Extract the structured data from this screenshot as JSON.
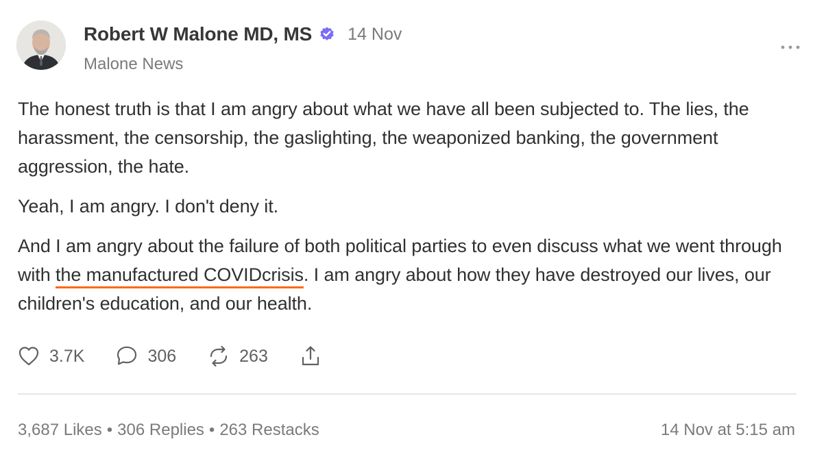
{
  "author": {
    "name": "Robert W Malone MD, MS",
    "publication": "Malone News",
    "date": "14 Nov",
    "verified_color": "#7b6df6"
  },
  "post": {
    "paragraphs": [
      {
        "text": "The honest truth is that I am angry about what we have all been subjected to. The lies, the harassment, the censorship, the gaslighting, the weaponized banking, the government aggression, the hate."
      },
      {
        "text": "Yeah, I am angry. I don't deny it."
      },
      {
        "before": "And I am angry about the failure of both political parties to even discuss what we went through with ",
        "link": "the manufactured COVIDcrisis",
        "after": ". I am angry about how they have destroyed our lives, our children's education, and our health."
      }
    ],
    "link_underline_color": "#ff6719"
  },
  "actions": {
    "likes": "3.7K",
    "replies": "306",
    "restacks": "263"
  },
  "stats": {
    "likes": "3,687 Likes",
    "separator": "•",
    "replies": "306 Replies",
    "restacks": "263 Restacks",
    "timestamp": "14 Nov at 5:15 am"
  },
  "icons": [
    "avatar",
    "verified-badge-icon",
    "more-options-icon",
    "heart-icon",
    "comment-icon",
    "restack-icon",
    "share-icon"
  ]
}
